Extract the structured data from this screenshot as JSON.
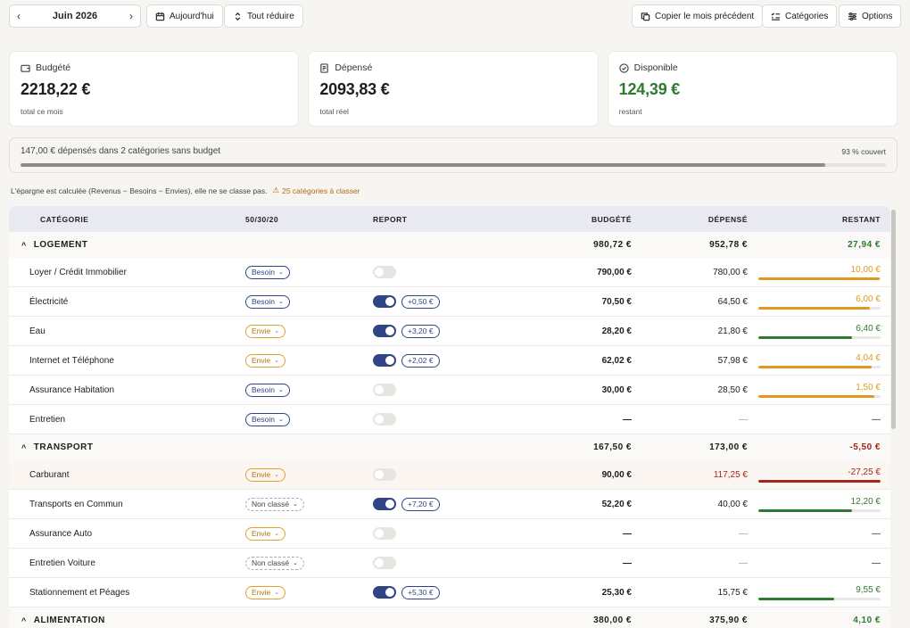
{
  "toolbar": {
    "month": "Juin 2026",
    "today": "Aujourd'hui",
    "collapse": "Tout réduire",
    "copy": "Copier le mois précédent",
    "categories": "Catégories",
    "options": "Options"
  },
  "cards": {
    "budget": {
      "label": "Budgété",
      "amount": "2218,22 €",
      "sub": "total ce mois"
    },
    "spent": {
      "label": "Dépensé",
      "amount": "2093,83 €",
      "sub": "total réel"
    },
    "available": {
      "label": "Disponible",
      "amount": "124,39 €",
      "sub": "restant"
    }
  },
  "coverage": {
    "text": "147,00 € dépensés dans 2 catégories sans budget",
    "percent_label": "93 % couvert",
    "percent": 93
  },
  "note": {
    "text": "L'épargne est calculée (Revenus − Besoins − Envies), elle ne se classe pas.",
    "warning": "25 catégories à classer"
  },
  "table": {
    "headers": {
      "category": "CATÉGORIE",
      "type": "50/30/20",
      "carry": "REPORT",
      "budget": "BUDGÉTÉ",
      "spent": "DÉPENSÉ",
      "remaining": "RESTANT"
    },
    "groups": [
      {
        "name": "LOGEMENT",
        "budget": "980,72 €",
        "spent": "952,78 €",
        "remaining": "27,94 €",
        "rows": [
          {
            "name": "Loyer / Crédit Immobilier",
            "type": "Besoin",
            "toggle": false,
            "carry": "",
            "budget": "790,00 €",
            "spent": "780,00 €",
            "remaining": "10,00 €",
            "level": "orange",
            "pct": 99
          },
          {
            "name": "Électricité",
            "type": "Besoin",
            "toggle": true,
            "carry": "+0,50 €",
            "budget": "70,50 €",
            "spent": "64,50 €",
            "remaining": "6,00 €",
            "level": "orange",
            "pct": 91
          },
          {
            "name": "Eau",
            "type": "Envie",
            "toggle": true,
            "carry": "+3,20 €",
            "budget": "28,20 €",
            "spent": "21,80 €",
            "remaining": "6,40 €",
            "level": "green",
            "pct": 77
          },
          {
            "name": "Internet et Téléphone",
            "type": "Envie",
            "toggle": true,
            "carry": "+2,02 €",
            "budget": "62,02 €",
            "spent": "57,98 €",
            "remaining": "4,04 €",
            "level": "orange",
            "pct": 93
          },
          {
            "name": "Assurance Habitation",
            "type": "Besoin",
            "toggle": false,
            "carry": "",
            "budget": "30,00 €",
            "spent": "28,50 €",
            "remaining": "1,50 €",
            "level": "orange",
            "pct": 95
          },
          {
            "name": "Entretien",
            "type": "Besoin",
            "toggle": false,
            "carry": "",
            "budget": "—",
            "spent": "—",
            "remaining": "—",
            "level": "none",
            "pct": 0
          }
        ]
      },
      {
        "name": "TRANSPORT",
        "budget": "167,50 €",
        "spent": "173,00 €",
        "remaining": "-5,50 €",
        "rows": [
          {
            "name": "Carburant",
            "type": "Envie",
            "toggle": false,
            "carry": "",
            "budget": "90,00 €",
            "spent": "117,25 €",
            "remaining": "-27,25 €",
            "level": "red",
            "pct": 100
          },
          {
            "name": "Transports en Commun",
            "type": "Non classé",
            "toggle": true,
            "carry": "+7,20 €",
            "budget": "52,20 €",
            "spent": "40,00 €",
            "remaining": "12,20 €",
            "level": "green",
            "pct": 77
          },
          {
            "name": "Assurance Auto",
            "type": "Envie",
            "toggle": false,
            "carry": "",
            "budget": "—",
            "spent": "—",
            "remaining": "—",
            "level": "none",
            "pct": 0
          },
          {
            "name": "Entretien Voiture",
            "type": "Non classé",
            "toggle": false,
            "carry": "",
            "budget": "—",
            "spent": "—",
            "remaining": "—",
            "level": "none",
            "pct": 0
          },
          {
            "name": "Stationnement et Péages",
            "type": "Envie",
            "toggle": true,
            "carry": "+5,30 €",
            "budget": "25,30 €",
            "spent": "15,75 €",
            "remaining": "9,55 €",
            "level": "green",
            "pct": 62
          }
        ]
      },
      {
        "name": "ALIMENTATION",
        "budget": "380,00 €",
        "spent": "375,90 €",
        "remaining": "4,10 €",
        "rows": []
      }
    ]
  },
  "colors": {
    "accent": "#2f4585",
    "green": "#2e7a2e",
    "orange": "#e09a1c",
    "red": "#a3261b"
  }
}
